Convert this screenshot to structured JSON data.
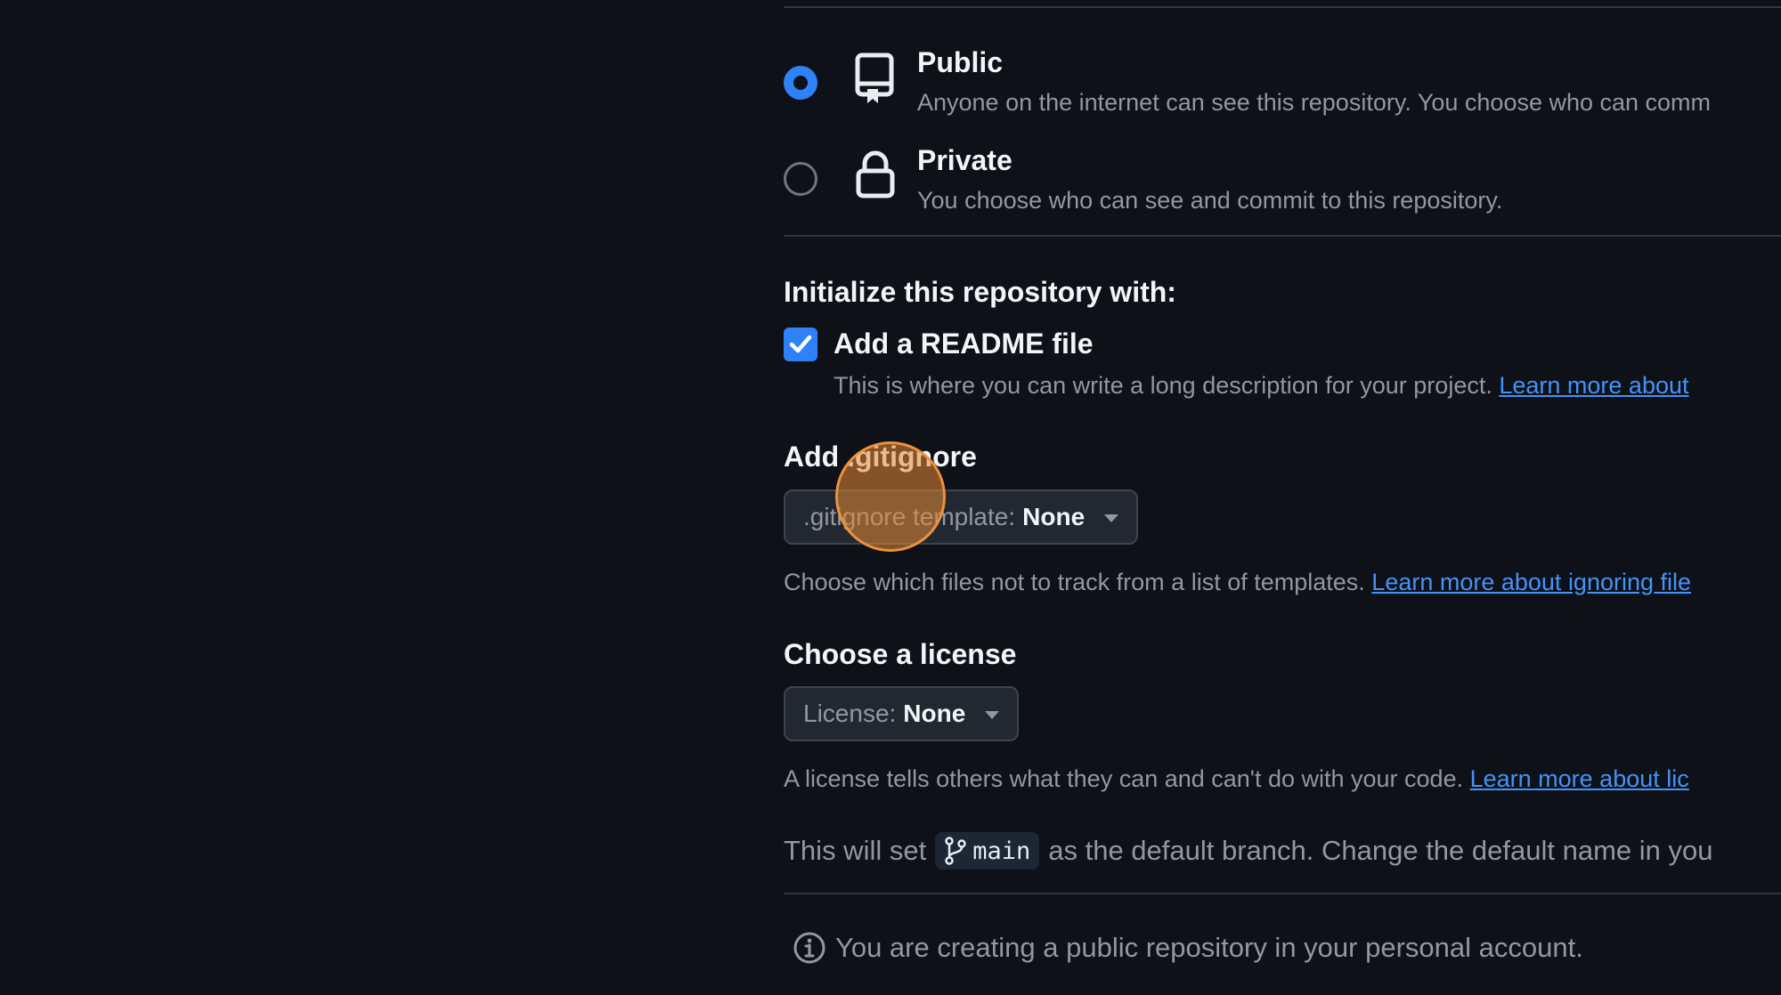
{
  "visibility": {
    "public": {
      "title": "Public",
      "description": "Anyone on the internet can see this repository. You choose who can comm",
      "icon": "repo-icon",
      "selected": true
    },
    "private": {
      "title": "Private",
      "description": "You choose who can see and commit to this repository.",
      "icon": "lock-icon",
      "selected": false
    }
  },
  "initialize": {
    "title": "Initialize this repository with:",
    "readme": {
      "label": "Add a README file",
      "checked": true,
      "help": "This is where you can write a long description for your project.",
      "link": "Learn more about"
    }
  },
  "gitignore": {
    "title": "Add .gitignore",
    "select_key": ".gitignore template:",
    "select_value": "None",
    "help": "Choose which files not to track from a list of templates.",
    "link": "Learn more about ignoring file"
  },
  "license": {
    "title": "Choose a license",
    "select_key": "License:",
    "select_value": "None",
    "help": "A license tells others what they can and can't do with your code.",
    "link": "Learn more about lic"
  },
  "branch": {
    "prefix": "This will set",
    "name": "main",
    "suffix": "as the default branch. Change the default name in you"
  },
  "notice": {
    "text": "You are creating a public repository in your personal account.",
    "icon": "info-icon"
  },
  "colors": {
    "background": "#0e1117",
    "accent": "#2f81f7",
    "link": "#4493f8",
    "cursor": "#e88b34"
  }
}
